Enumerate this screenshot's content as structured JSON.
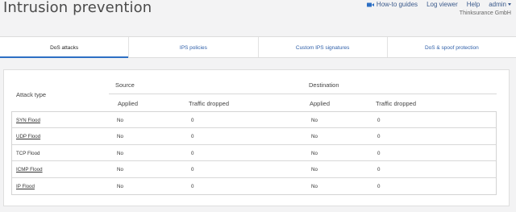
{
  "header": {
    "title": "Intrusion prevention",
    "nav": {
      "howto": "How-to guides",
      "log_viewer": "Log viewer",
      "help": "Help",
      "user": "admin"
    },
    "org": "Thinksurance GmbH"
  },
  "tabs": [
    {
      "label": "DoS attacks",
      "active": true
    },
    {
      "label": "IPS policies",
      "active": false
    },
    {
      "label": "Custom IPS signatures",
      "active": false
    },
    {
      "label": "DoS & spoof protection",
      "active": false
    }
  ],
  "table": {
    "attack_type_header": "Attack type",
    "source_header": "Source",
    "destination_header": "Destination",
    "applied_header": "Applied",
    "traffic_dropped_header": "Traffic dropped",
    "rows": [
      {
        "attack": "SYN Flood",
        "link": true,
        "src_applied": "No",
        "src_dropped": "0",
        "dst_applied": "No",
        "dst_dropped": "0"
      },
      {
        "attack": "UDP Flood",
        "link": true,
        "src_applied": "No",
        "src_dropped": "0",
        "dst_applied": "No",
        "dst_dropped": "0"
      },
      {
        "attack": "TCP Flood",
        "link": false,
        "src_applied": "No",
        "src_dropped": "0",
        "dst_applied": "No",
        "dst_dropped": "0"
      },
      {
        "attack": "ICMP Flood",
        "link": true,
        "src_applied": "No",
        "src_dropped": "0",
        "dst_applied": "No",
        "dst_dropped": "0"
      },
      {
        "attack": "IP Flood",
        "link": true,
        "src_applied": "No",
        "src_dropped": "0",
        "dst_applied": "No",
        "dst_dropped": "0"
      }
    ]
  },
  "colors": {
    "accent": "#2d6fc4",
    "link": "#2d5ea8",
    "nav": "#3b5a8c"
  },
  "icons": {
    "howto": "video-camera-icon",
    "user_menu": "caret-down-icon"
  }
}
